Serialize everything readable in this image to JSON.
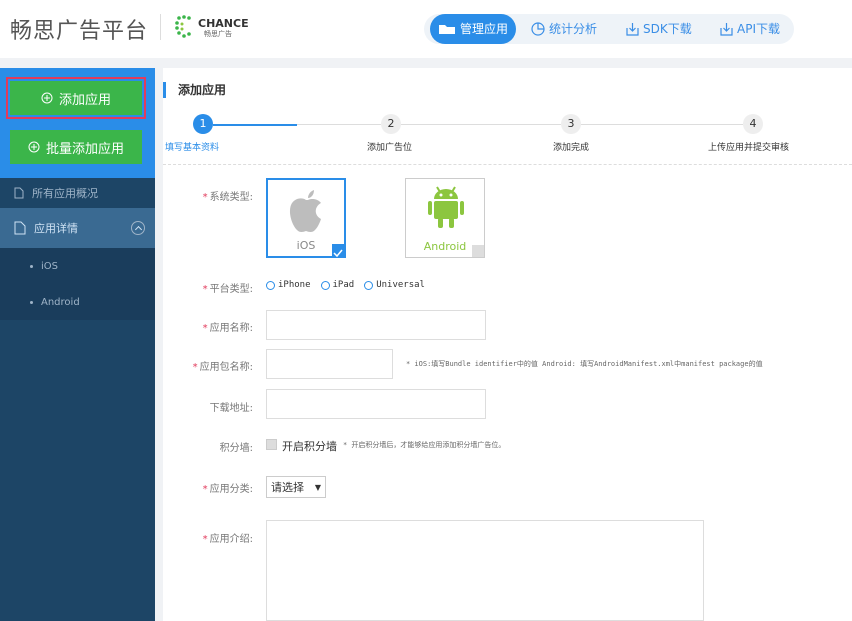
{
  "header": {
    "brand": "畅思广告平台",
    "logo_text": "CHANCE",
    "logo_sub": "畅思广告",
    "nav": [
      {
        "label": "管理应用",
        "icon": "folder-icon",
        "active": true
      },
      {
        "label": "统计分析",
        "icon": "pie-chart-icon",
        "active": false
      },
      {
        "label": "SDK下载",
        "icon": "download-icon",
        "active": false
      },
      {
        "label": "API下载",
        "icon": "download-icon",
        "active": false
      }
    ]
  },
  "sidebar": {
    "add_app": "添加应用",
    "batch_add": "批量添加应用",
    "items": [
      {
        "label": "所有应用概况",
        "icon": "document-icon"
      },
      {
        "label": "应用详情",
        "icon": "document-icon"
      }
    ],
    "sub_items": [
      "iOS",
      "Android"
    ]
  },
  "main": {
    "title": "添加应用",
    "steps": [
      {
        "num": "1",
        "label": "填写基本资料"
      },
      {
        "num": "2",
        "label": "添加广告位"
      },
      {
        "num": "3",
        "label": "添加完成"
      },
      {
        "num": "4",
        "label": "上传应用并提交审核"
      }
    ],
    "form": {
      "system_type_label": "系统类型:",
      "os_options": [
        "iOS",
        "Android"
      ],
      "platform_label": "平台类型:",
      "platforms": [
        "iPhone",
        "iPad",
        "Universal"
      ],
      "app_name_label": "应用名称:",
      "package_label": "应用包名称:",
      "package_hint": "* iOS:填写Bundle identifier中的值 Android: 填写AndroidManifest.xml中manifest package的值",
      "download_label": "下载地址:",
      "wall_label": "积分墙:",
      "wall_checkbox_label": "开启积分墙",
      "wall_hint": "* 开启积分墙后，才能够给应用添加积分墙广告位。",
      "category_label": "应用分类:",
      "category_value": "请选择",
      "intro_label": "应用介绍:"
    }
  },
  "colors": {
    "accent": "#2a8de8",
    "green": "#3bb54a",
    "sidebar": "#1d4566",
    "required": "#e23b5c"
  }
}
